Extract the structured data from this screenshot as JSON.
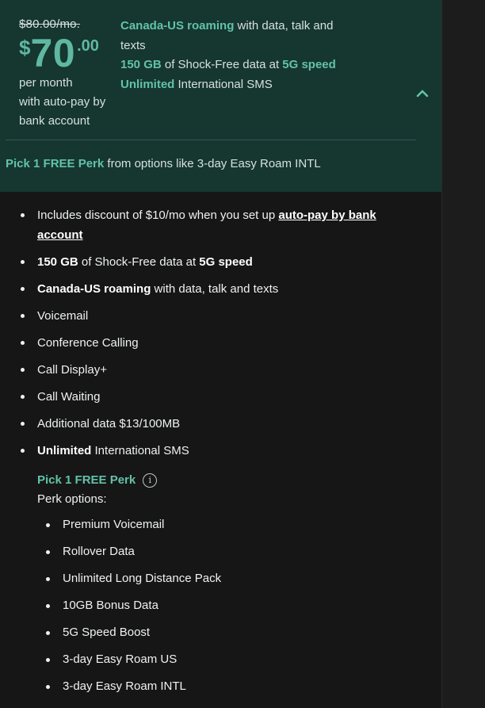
{
  "plan": {
    "old_price": "$80.00/mo.",
    "currency": "$",
    "price_main": "70",
    "price_cents": ".00",
    "caption": [
      "per month",
      "with auto-pay by",
      "bank account"
    ]
  },
  "highlights": [
    {
      "bold": "Canada-US roaming",
      "rest": " with data, talk and texts"
    },
    {
      "bold": "150 GB",
      "rest": " of Shock-Free data at ",
      "bold2": "5G speed"
    },
    {
      "bold": "Unlimited",
      "rest": " International SMS"
    }
  ],
  "collapse_icon": "chevron-up-icon",
  "perk_banner": {
    "bold": "Pick 1 FREE Perk",
    "rest": " from options like 3-day Easy Roam INTL"
  },
  "features": [
    {
      "pre": "Includes discount of $10/mo when you set up ",
      "link": "auto-pay by bank account"
    },
    {
      "bold": "150 GB",
      "mid": " of Shock-Free data at ",
      "bold2": "5G speed"
    },
    {
      "bold": "Canada-US roaming",
      "mid": " with data, talk and texts"
    },
    {
      "text": "Voicemail"
    },
    {
      "text": "Conference Calling"
    },
    {
      "text": "Call Display+"
    },
    {
      "text": "Call Waiting"
    },
    {
      "text": "Additional data $13/100MB"
    },
    {
      "bold": "Unlimited",
      "mid": " International SMS"
    }
  ],
  "perks": {
    "title": "Pick 1 FREE Perk",
    "info_icon": "info-icon",
    "info_glyph": "i",
    "subtitle": "Perk options:",
    "options": [
      "Premium Voicemail",
      "Rollover Data",
      "Unlimited Long Distance Pack",
      "10GB Bonus Data",
      "5G Speed Boost",
      "3-day Easy Roam US",
      "3-day Easy Roam INTL"
    ]
  },
  "colors": {
    "card_bg": "#163630",
    "accent": "#62c2a8",
    "page_bg": "#161616"
  }
}
